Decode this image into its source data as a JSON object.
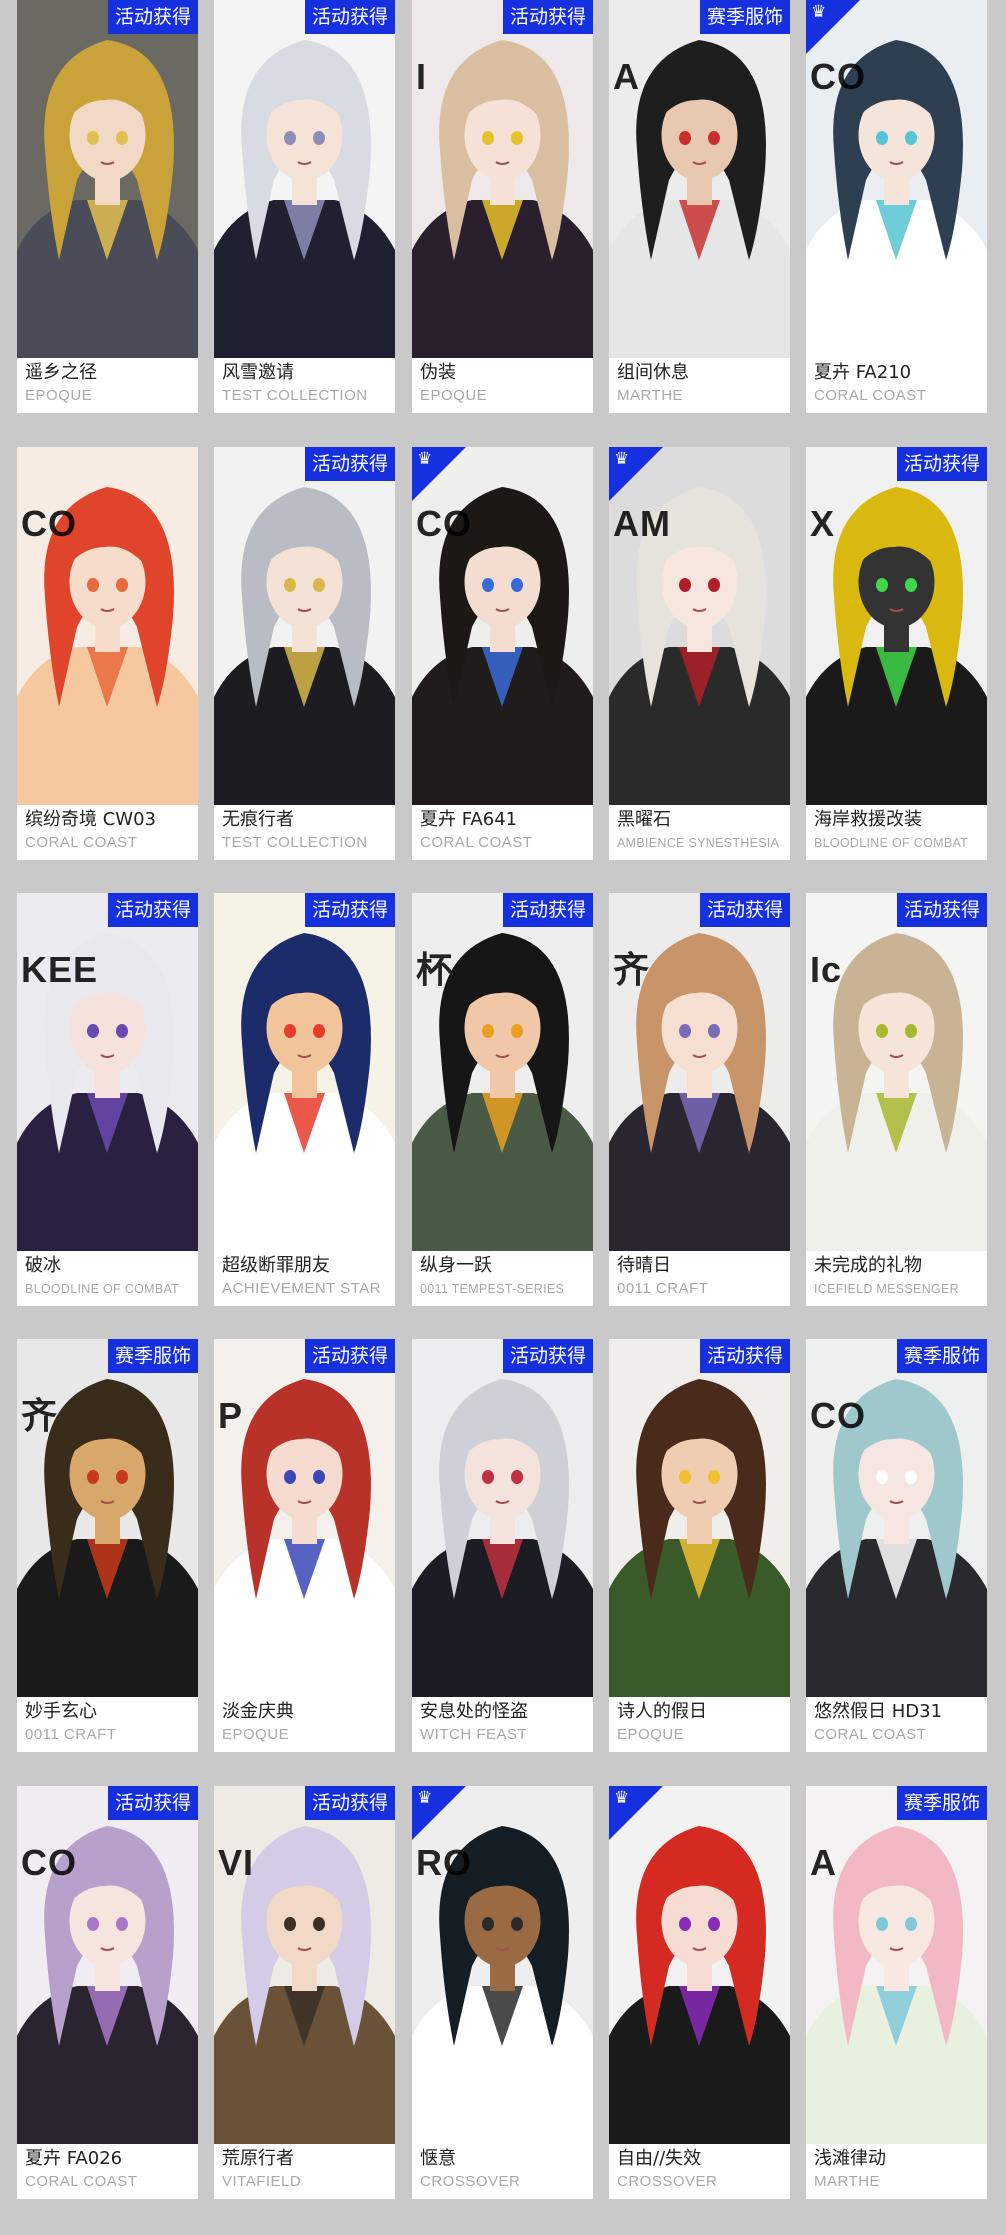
{
  "rows": [
    [
      {
        "name": "遥乡之径",
        "series": "EPOQUE",
        "tag": "活动获得",
        "corner": false,
        "bg": "#6b6a62",
        "hair": "#c9a23a",
        "skin": "#f1d9c6",
        "outfit": "#4a4d57",
        "accent": "#e0c050",
        "watermark": ""
      },
      {
        "name": "风雪邀请",
        "series": "TEST COLLECTION",
        "tag": "活动获得",
        "corner": false,
        "bg": "#f4f4f4",
        "hair": "#d8dbe3",
        "skin": "#f6e3d8",
        "outfit": "#1f2030",
        "accent": "#8d8fb8",
        "watermark": ""
      },
      {
        "name": "伪装",
        "series": "EPOQUE",
        "tag": "活动获得",
        "corner": false,
        "bg": "#efe8ea",
        "hair": "#d9bea0",
        "skin": "#f6e1d6",
        "outfit": "#2a1f2c",
        "accent": "#e7c12a",
        "watermark": "I"
      },
      {
        "name": "组间休息",
        "series": "MARTHE",
        "tag": "赛季服饰",
        "corner": false,
        "bg": "#ececec",
        "hair": "#1e1e1e",
        "skin": "#e8c8b0",
        "outfit": "#e6e6e6",
        "accent": "#c83030",
        "watermark": "A"
      },
      {
        "name": "夏卉 FA210",
        "series": "CORAL COAST",
        "tag": "",
        "corner": true,
        "bg": "#e8eef2",
        "hair": "#2f3f52",
        "skin": "#f5e4da",
        "outfit": "#ffffff",
        "accent": "#56c4d4",
        "watermark": "CO"
      }
    ],
    [
      {
        "name": "缤纷奇境 CW03",
        "series": "CORAL COAST",
        "tag": "",
        "corner": false,
        "bg": "#f7ece4",
        "hair": "#e0442a",
        "skin": "#f6dccb",
        "outfit": "#f6c8a0",
        "accent": "#e86a3a",
        "watermark": "CO"
      },
      {
        "name": "无痕行者",
        "series": "TEST COLLECTION",
        "tag": "活动获得",
        "corner": false,
        "bg": "#f2f2f2",
        "hair": "#b9bcc4",
        "skin": "#f5e2d6",
        "outfit": "#1c1c22",
        "accent": "#d8b84a",
        "watermark": ""
      },
      {
        "name": "夏卉 FA641",
        "series": "CORAL COAST",
        "tag": "",
        "corner": true,
        "bg": "#eeeeea",
        "hair": "#1c1814",
        "skin": "#f2ddd0",
        "outfit": "#201c1c",
        "accent": "#3a6ad8",
        "watermark": "CO"
      },
      {
        "name": "黑曜石",
        "series": "AMBIENCE SYNESTHESIA",
        "tag": "",
        "corner": true,
        "bg": "#dcdcdc",
        "hair": "#e6e2dc",
        "skin": "#f6e6de",
        "outfit": "#2a2a2a",
        "accent": "#b01e28",
        "watermark": "AM"
      },
      {
        "name": "海岸救援改装",
        "series": "BLOODLINE OF COMBAT",
        "tag": "活动获得",
        "corner": false,
        "bg": "#f0f0f0",
        "hair": "#d9b810",
        "skin": "#333333",
        "outfit": "#1a1a1a",
        "accent": "#3fd84a",
        "watermark": "X"
      }
    ],
    [
      {
        "name": "破冰",
        "series": "BLOODLINE OF COMBAT",
        "tag": "活动获得",
        "corner": false,
        "bg": "#ececf0",
        "hair": "#e8e8ee",
        "skin": "#f6e2dc",
        "outfit": "#2a2140",
        "accent": "#6a4ab0",
        "watermark": "KEE"
      },
      {
        "name": "超级断罪朋友",
        "series": "ACHIEVEMENT STAR",
        "tag": "活动获得",
        "corner": false,
        "bg": "#f6f2e6",
        "hair": "#1c2c6a",
        "skin": "#f2c49a",
        "outfit": "#ffffff",
        "accent": "#e83a2a",
        "watermark": ""
      },
      {
        "name": "纵身一跃",
        "series": "0011 TEMPEST-SERIES",
        "tag": "活动获得",
        "corner": false,
        "bg": "#eeeeee",
        "hair": "#161616",
        "skin": "#f0c8a8",
        "outfit": "#4a5a44",
        "accent": "#e8a020",
        "watermark": "杯"
      },
      {
        "name": "待晴日",
        "series": "0011 CRAFT",
        "tag": "活动获得",
        "corner": false,
        "bg": "#ececea",
        "hair": "#c8946a",
        "skin": "#f5dfd0",
        "outfit": "#2a2630",
        "accent": "#7a6ab8",
        "watermark": "齐"
      },
      {
        "name": "未完成的礼物",
        "series": "ICEFIELD MESSENGER",
        "tag": "活动获得",
        "corner": false,
        "bg": "#f4f4f2",
        "hair": "#c8b494",
        "skin": "#f6e4d8",
        "outfit": "#f0f0ea",
        "accent": "#a8b830",
        "watermark": "Ic"
      }
    ],
    [
      {
        "name": "妙手玄心",
        "series": "0011 CRAFT",
        "tag": "赛季服饰",
        "corner": false,
        "bg": "#e8e8e8",
        "hair": "#3a2c1a",
        "skin": "#d8a86a",
        "outfit": "#1a1a1a",
        "accent": "#c83a1a",
        "watermark": "齐"
      },
      {
        "name": "淡金庆典",
        "series": "EPOQUE",
        "tag": "活动获得",
        "corner": false,
        "bg": "#f4f0ec",
        "hair": "#b8322a",
        "skin": "#f6dcd0",
        "outfit": "#ffffff",
        "accent": "#3a48b8",
        "watermark": "P"
      },
      {
        "name": "安息处的怪盗",
        "series": "WITCH FEAST",
        "tag": "活动获得",
        "corner": false,
        "bg": "#ecedee",
        "hair": "#cdd0d6",
        "skin": "#f4e2dc",
        "outfit": "#1c1c24",
        "accent": "#c03040",
        "watermark": ""
      },
      {
        "name": "诗人的假日",
        "series": "EPOQUE",
        "tag": "活动获得",
        "corner": false,
        "bg": "#f0eeea",
        "hair": "#4a2a1a",
        "skin": "#f0ccb0",
        "outfit": "#3a5a2a",
        "accent": "#f0c030",
        "watermark": ""
      },
      {
        "name": "悠然假日 HD31",
        "series": "CORAL COAST",
        "tag": "赛季服饰",
        "corner": false,
        "bg": "#eef0f0",
        "hair": "#9ec8cc",
        "skin": "#f6e6e2",
        "outfit": "#2a2a2e",
        "accent": "#ffffff",
        "watermark": "CO"
      }
    ],
    [
      {
        "name": "夏卉 FA026",
        "series": "CORAL COAST",
        "tag": "活动获得",
        "corner": false,
        "bg": "#f0ecf2",
        "hair": "#b8a0cc",
        "skin": "#f6e4de",
        "outfit": "#2a2430",
        "accent": "#a878c8",
        "watermark": "CO"
      },
      {
        "name": "荒原行者",
        "series": "VITAFIELD",
        "tag": "活动获得",
        "corner": false,
        "bg": "#eeeae4",
        "hair": "#d4cce6",
        "skin": "#f2d8c6",
        "outfit": "#6a5238",
        "accent": "#3a3028",
        "watermark": "VI"
      },
      {
        "name": "惬意",
        "series": "CROSSOVER",
        "tag": "",
        "corner": true,
        "bg": "#eeeeee",
        "hair": "#141c24",
        "skin": "#9a6a44",
        "outfit": "#ffffff",
        "accent": "#2a2a2a",
        "watermark": "RO"
      },
      {
        "name": "自由//失效",
        "series": "CROSSOVER",
        "tag": "",
        "corner": true,
        "bg": "#f2f2f2",
        "hair": "#d42a22",
        "skin": "#f6dcd2",
        "outfit": "#1a1a1a",
        "accent": "#8a2ab8",
        "watermark": ""
      },
      {
        "name": "浅滩律动",
        "series": "MARTHE",
        "tag": "赛季服饰",
        "corner": false,
        "bg": "#f4f2f2",
        "hair": "#f2b8c4",
        "skin": "#f8e8e2",
        "outfit": "#e8f0e0",
        "accent": "#80c8d8",
        "watermark": "A"
      }
    ]
  ]
}
